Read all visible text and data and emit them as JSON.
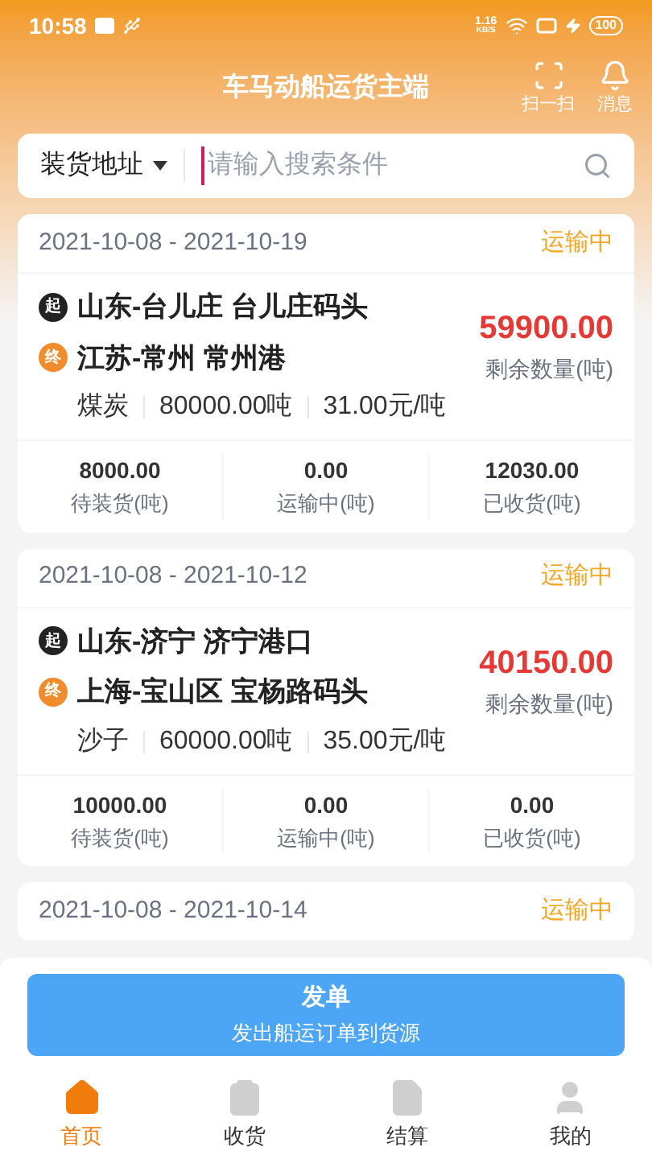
{
  "status_bar": {
    "time": "10:58",
    "net_speed_value": "1.16",
    "net_speed_unit": "KB/S",
    "battery": "100"
  },
  "header": {
    "title": "车马动船运货主端",
    "actions": [
      {
        "label": "扫一扫"
      },
      {
        "label": "消息"
      }
    ]
  },
  "search": {
    "filter": "装货地址",
    "placeholder": "请输入搜索条件"
  },
  "orders": [
    {
      "date_range": "2021-10-08 - 2021-10-19",
      "status": "运输中",
      "origin_badge": "起",
      "origin": "山东-台儿庄 台儿庄码头",
      "destination_badge": "终",
      "destination": "江苏-常州 常州港",
      "cargo": "煤炭",
      "quantity": "80000.00吨",
      "price": "31.00元/吨",
      "remaining": "59900.00",
      "remaining_label": "剩余数量(吨)",
      "stats": [
        {
          "value": "8000.00",
          "label": "待装货(吨)"
        },
        {
          "value": "0.00",
          "label": "运输中(吨)"
        },
        {
          "value": "12030.00",
          "label": "已收货(吨)"
        }
      ]
    },
    {
      "date_range": "2021-10-08 - 2021-10-12",
      "status": "运输中",
      "origin_badge": "起",
      "origin": "山东-济宁 济宁港口",
      "destination_badge": "终",
      "destination": "上海-宝山区 宝杨路码头",
      "cargo": "沙子",
      "quantity": "60000.00吨",
      "price": "35.00元/吨",
      "remaining": "40150.00",
      "remaining_label": "剩余数量(吨)",
      "stats": [
        {
          "value": "10000.00",
          "label": "待装货(吨)"
        },
        {
          "value": "0.00",
          "label": "运输中(吨)"
        },
        {
          "value": "0.00",
          "label": "已收货(吨)"
        }
      ]
    },
    {
      "date_range": "2021-10-08 - 2021-10-14",
      "status": "运输中"
    }
  ],
  "action_button": {
    "title": "发单",
    "subtitle": "发出船运订单到货源"
  },
  "tabs": [
    {
      "label": "首页",
      "selected": true
    },
    {
      "label": "收货",
      "selected": false
    },
    {
      "label": "结算",
      "selected": false
    },
    {
      "label": "我的",
      "selected": false
    }
  ]
}
